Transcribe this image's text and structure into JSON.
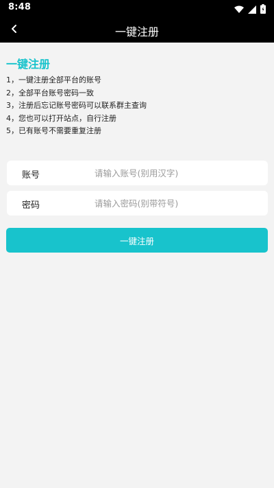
{
  "status_bar": {
    "time": "8:48",
    "icons": [
      "wifi-icon",
      "signal-icon",
      "battery-icon"
    ]
  },
  "header": {
    "back_icon": "chevron-left-icon",
    "title": "一键注册"
  },
  "main": {
    "section_title": "一键注册",
    "rules": [
      "1，一键注册全部平台的账号",
      "2，全部平台账号密码一致",
      "3，注册后忘记账号密码可以联系群主查询",
      "4，您也可以打开站点，自行注册",
      "5，已有账号不需要重复注册"
    ],
    "account": {
      "label": "账号",
      "value": "",
      "placeholder": "请输入账号(别用汉字)"
    },
    "password": {
      "label": "密码",
      "value": "",
      "placeholder": "请输入密码(别带符号)"
    },
    "submit_label": "一键注册"
  },
  "colors": {
    "accent": "#18c3cc",
    "header_bg": "#000000",
    "page_bg": "#f3f3f3"
  }
}
